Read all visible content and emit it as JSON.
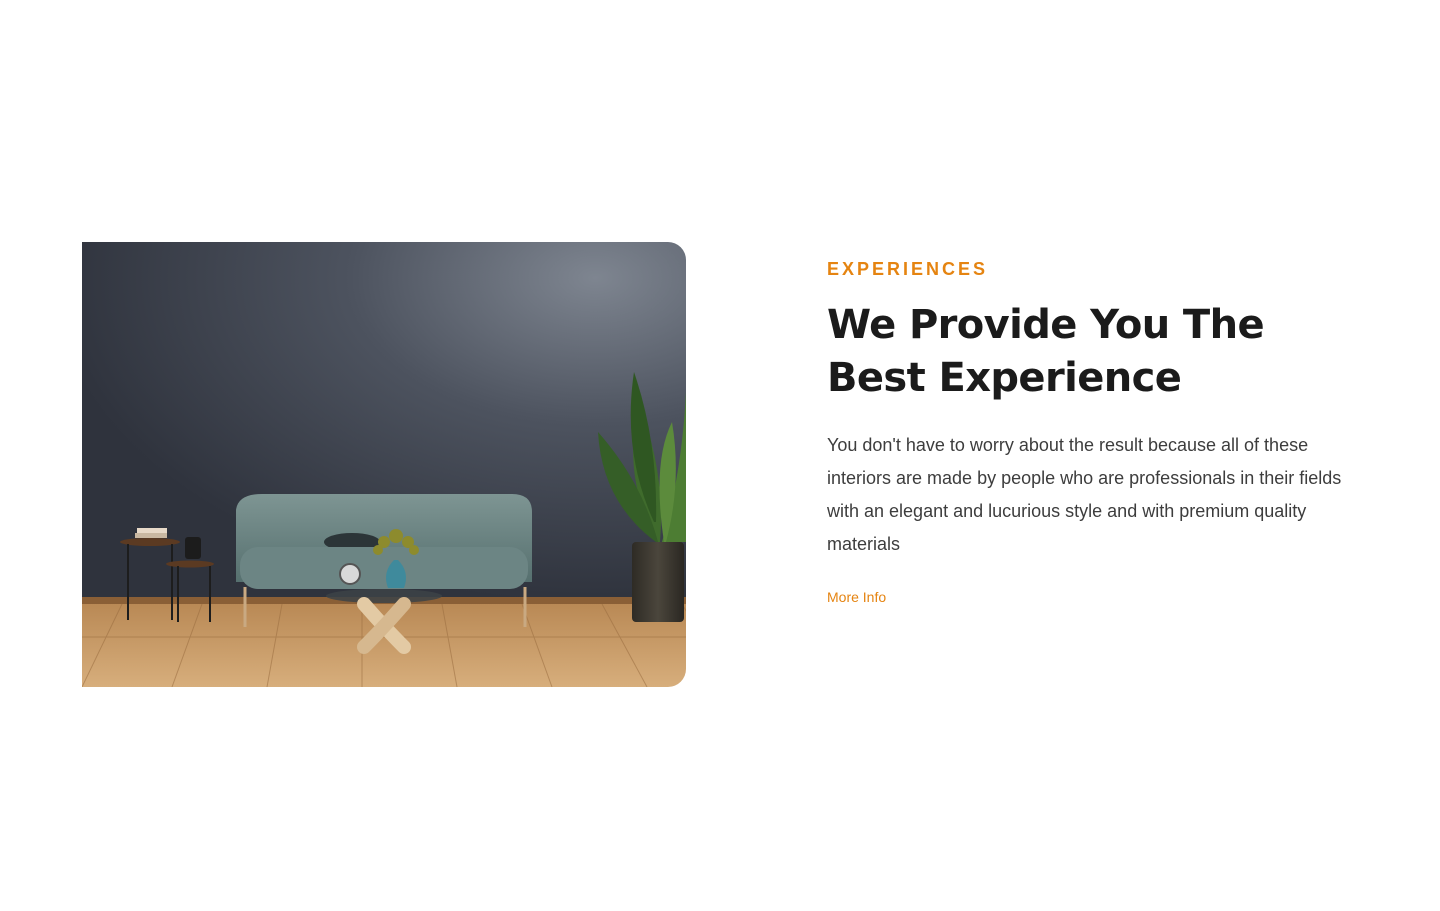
{
  "section": {
    "eyebrow": "EXPERIENCES",
    "headline_line1": "We Provide You The",
    "headline_line2": "Best Experience",
    "body": "You don't have to worry about the result because all of these interiors are made by people who are professionals in their fields with an elegant and lucurious style and with premium quality materials",
    "link_label": "More Info"
  },
  "colors": {
    "accent": "#E58411",
    "heading": "#1b1b1b",
    "body": "#3d3d3d",
    "background": "#ffffff"
  }
}
